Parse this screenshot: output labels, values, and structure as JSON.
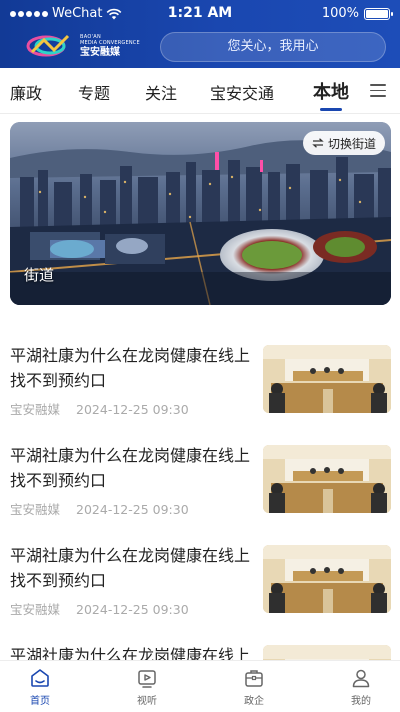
{
  "status_bar": {
    "carrier": "WeChat",
    "time": "1:21 AM",
    "battery": "100%"
  },
  "header": {
    "logo_en_line1": "BAO'AN",
    "logo_en_line2": "MEDIA CONVERGENCE",
    "logo_cn": "宝安融媒",
    "search_text": "您关心，我用心"
  },
  "tabs": [
    {
      "label": "廉政"
    },
    {
      "label": "专题"
    },
    {
      "label": "关注"
    },
    {
      "label": "宝安交通"
    },
    {
      "label": "本地"
    }
  ],
  "active_tab": "本地",
  "hero": {
    "switch_label": "切换街道",
    "caption": "街道"
  },
  "news": [
    {
      "title": "平湖社康为什么在龙岗健康在线上找不到预约口",
      "source": "宝安融媒",
      "date": "2024-12-25 09:30"
    },
    {
      "title": "平湖社康为什么在龙岗健康在线上找不到预约口",
      "source": "宝安融媒",
      "date": "2024-12-25 09:30"
    },
    {
      "title": "平湖社康为什么在龙岗健康在线上找不到预约口",
      "source": "宝安融媒",
      "date": "2024-12-25 09:30"
    },
    {
      "title": "平湖社康为什么在龙岗健康在线上找不到预约口",
      "source": "",
      "date": ""
    }
  ],
  "bottom_nav": [
    {
      "label": "首页",
      "icon": "home-icon",
      "active": true
    },
    {
      "label": "视听",
      "icon": "video-icon",
      "active": false
    },
    {
      "label": "政企",
      "icon": "briefcase-icon",
      "active": false
    },
    {
      "label": "我的",
      "icon": "user-icon",
      "active": false
    }
  ],
  "colors": {
    "brand": "#1a47b0",
    "header_dark": "#123a96"
  }
}
